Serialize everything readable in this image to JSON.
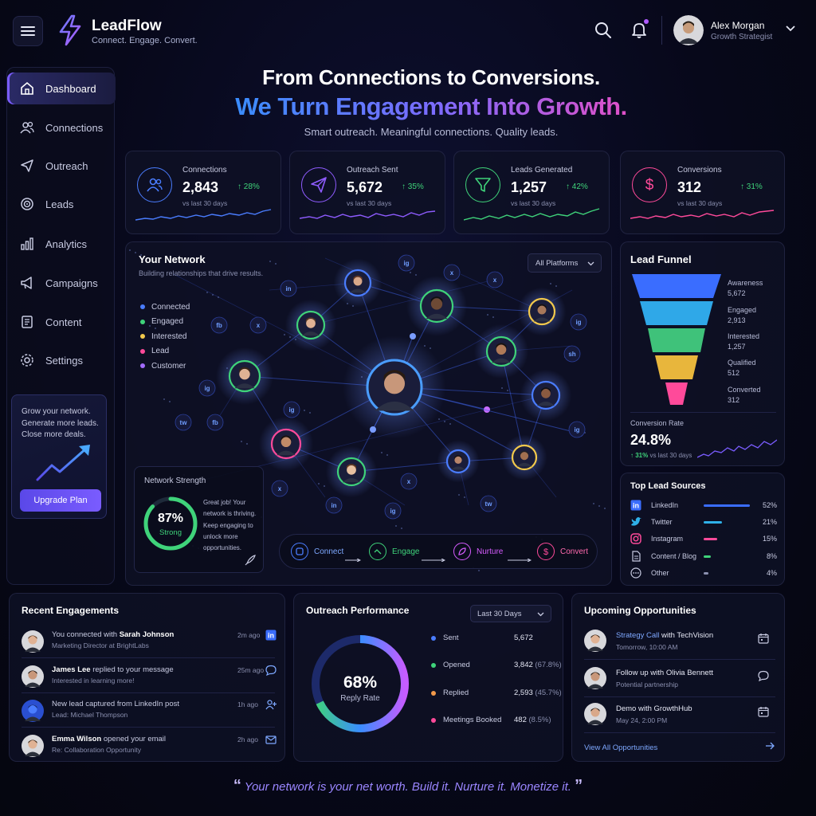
{
  "header": {
    "brand": "LeadFlow",
    "tagline": "Connect. Engage. Convert.",
    "user_name": "Alex Morgan",
    "user_role": "Growth Strategist"
  },
  "sidebar": {
    "items": [
      {
        "label": "Dashboard",
        "icon": "home-icon"
      },
      {
        "label": "Connections",
        "icon": "users-icon"
      },
      {
        "label": "Outreach",
        "icon": "send-icon"
      },
      {
        "label": "Leads",
        "icon": "target-icon"
      },
      {
        "label": "Analytics",
        "icon": "bar-chart-icon"
      },
      {
        "label": "Campaigns",
        "icon": "megaphone-icon"
      },
      {
        "label": "Content",
        "icon": "document-icon"
      },
      {
        "label": "Settings",
        "icon": "gear-icon"
      }
    ],
    "promo_text": "Grow your network. Generate more leads. Close more deals.",
    "upgrade_label": "Upgrade Plan"
  },
  "hero": {
    "line1": "From Connections to Conversions.",
    "line2": "We Turn Engagement Into Growth.",
    "line3": "Smart outreach. Meaningful connections. Quality leads."
  },
  "kpis": [
    {
      "label": "Connections",
      "value": "2,843",
      "delta": "↑ 28%",
      "sub": "vs last 30 days",
      "color": "#4a7dff",
      "icon": "users-icon"
    },
    {
      "label": "Outreach Sent",
      "value": "5,672",
      "delta": "↑ 35%",
      "sub": "vs last 30 days",
      "color": "#8f5cff",
      "icon": "send-icon"
    },
    {
      "label": "Leads Generated",
      "value": "1,257",
      "delta": "↑ 42%",
      "sub": "vs last 30 days",
      "color": "#3fd37a",
      "icon": "funnel-icon"
    },
    {
      "label": "Conversions",
      "value": "312",
      "delta": "↑ 31%",
      "sub": "vs last 30 days",
      "color": "#ff4a9a",
      "icon": "dollar-icon"
    }
  ],
  "network": {
    "title": "Your Network",
    "subtitle": "Building relationships that drive results.",
    "platform_select": "All Platforms",
    "legend": [
      {
        "label": "Connected",
        "color": "#4a7dff"
      },
      {
        "label": "Engaged",
        "color": "#3fd37a"
      },
      {
        "label": "Interested",
        "color": "#f2c94c"
      },
      {
        "label": "Lead",
        "color": "#ff4a9a"
      },
      {
        "label": "Customer",
        "color": "#a36cff"
      }
    ],
    "strength_title": "Network Strength",
    "strength_value": "87%",
    "strength_fraction": 0.87,
    "strength_label": "Strong",
    "strength_text": "Great job! Your network is thriving. Keep engaging to unlock more opportunities.",
    "flow": [
      {
        "label": "Connect",
        "color": "#4a7dff"
      },
      {
        "label": "Engage",
        "color": "#3fd37a"
      },
      {
        "label": "Nurture",
        "color": "#d65cff"
      },
      {
        "label": "Convert",
        "color": "#ff4a9a"
      }
    ]
  },
  "funnel": {
    "title": "Lead Funnel",
    "stages": [
      {
        "label": "Awareness",
        "value": "5,672",
        "color": "#3a6dff"
      },
      {
        "label": "Engaged",
        "value": "2,913",
        "color": "#2fa8e8"
      },
      {
        "label": "Interested",
        "value": "1,257",
        "color": "#3fc27a"
      },
      {
        "label": "Qualified",
        "value": "512",
        "color": "#e8b63c"
      },
      {
        "label": "Converted",
        "value": "312",
        "color": "#ff4a9a"
      }
    ],
    "conversion_label": "Conversion Rate",
    "conversion_value": "24.8%",
    "conversion_delta": "↑ 31%",
    "conversion_sub": "vs last 30 days"
  },
  "sources": {
    "title": "Top Lead Sources",
    "items": [
      {
        "name": "LinkedIn",
        "pct": "52%",
        "value": 0.52,
        "color": "#3a6dff",
        "icon": "linkedin-icon"
      },
      {
        "name": "Twitter",
        "pct": "21%",
        "value": 0.21,
        "color": "#2fb0e8",
        "icon": "twitter-icon"
      },
      {
        "name": "Instagram",
        "pct": "15%",
        "value": 0.15,
        "color": "#ff4a9a",
        "icon": "instagram-icon"
      },
      {
        "name": "Content / Blog",
        "pct": "8%",
        "value": 0.08,
        "color": "#3fd37a",
        "icon": "document-icon"
      },
      {
        "name": "Other",
        "pct": "4%",
        "value": 0.04,
        "color": "#8b90b0",
        "icon": "more-icon"
      }
    ]
  },
  "recent": {
    "title": "Recent Engagements",
    "items": [
      {
        "pre": "You connected with ",
        "name": "Sarah Johnson",
        "post": "",
        "sub": "Marketing Director at BrightLabs",
        "time": "2m ago",
        "icon": "linkedin-icon"
      },
      {
        "pre": "",
        "name": "James Lee",
        "post": " replied to your message",
        "sub": "Interested in learning more!",
        "time": "25m ago",
        "icon": "chat-icon"
      },
      {
        "pre": "New lead captured from LinkedIn post",
        "name": "",
        "post": "",
        "sub": "Lead: Michael Thompson",
        "time": "1h ago",
        "icon": "add-user-icon"
      },
      {
        "pre": "",
        "name": "Emma Wilson",
        "post": " opened your email",
        "sub": "Re: Collaboration Opportunity",
        "time": "2h ago",
        "icon": "mail-icon"
      }
    ]
  },
  "performance": {
    "title": "Outreach Performance",
    "period": "Last 30 Days",
    "reply_rate": "68%",
    "reply_rate_fraction": 0.68,
    "reply_label": "Reply Rate",
    "rows": [
      {
        "label": "Sent",
        "value": "5,672",
        "pct": "",
        "color": "#4a7dff"
      },
      {
        "label": "Opened",
        "value": "3,842",
        "pct": " (67.8%)",
        "color": "#3fd37a"
      },
      {
        "label": "Replied",
        "value": "2,593",
        "pct": " (45.7%)",
        "color": "#f2994a"
      },
      {
        "label": "Meetings Booked",
        "value": "482",
        "pct": " (8.5%)",
        "color": "#ff4a9a"
      }
    ]
  },
  "upcoming": {
    "title": "Upcoming Opportunities",
    "items": [
      {
        "hl": "Strategy Call",
        "rest": " with TechVision",
        "sub": "Tomorrow, 10:00 AM",
        "icon": "calendar-icon"
      },
      {
        "hl": "",
        "rest": "Follow up with Olivia Bennett",
        "sub": "Potential partnership",
        "icon": "chat-icon"
      },
      {
        "hl": "",
        "rest": "Demo with  GrowthHub",
        "sub": "May 24, 2:00 PM",
        "icon": "calendar-icon"
      }
    ],
    "view_all": "View All Opportunities"
  },
  "quote": "Your network is your net worth. Build it. Nurture it. Monetize it."
}
